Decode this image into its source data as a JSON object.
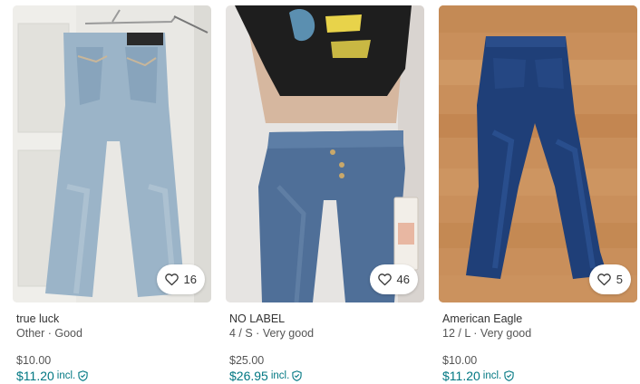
{
  "accent_color": "#007782",
  "items": [
    {
      "favorites": "16",
      "brand": "true luck",
      "subtitle": "Other · Good",
      "price": "$10.00",
      "total_price": "$11.20",
      "incl_label": "incl.",
      "photo_desc": "light-wash-flare-jeans-photo"
    },
    {
      "favorites": "46",
      "brand": "NO LABEL",
      "subtitle": "4 / S · Very good",
      "price": "$25.00",
      "total_price": "$26.95",
      "incl_label": "incl.",
      "photo_desc": "low-rise-jeans-worn-photo"
    },
    {
      "favorites": "5",
      "brand": "American Eagle",
      "subtitle": "12 / L · Very good",
      "price": "$10.00",
      "total_price": "$11.20",
      "incl_label": "incl.",
      "photo_desc": "dark-skinny-jeans-photo"
    }
  ]
}
